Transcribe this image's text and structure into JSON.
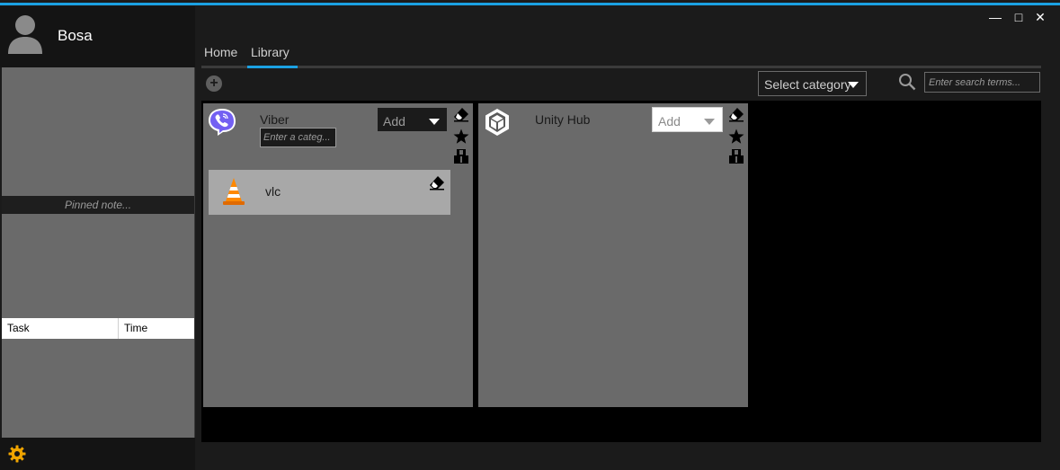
{
  "user": {
    "name": "Bosa"
  },
  "sidebar": {
    "pinned_note": "Pinned note...",
    "task_table": {
      "columns": [
        "Task",
        "Time"
      ]
    }
  },
  "tabs": [
    {
      "label": "Home",
      "active": false
    },
    {
      "label": "Library",
      "active": true
    }
  ],
  "toolbar": {
    "select_category": "Select category",
    "search_placeholder": "Enter search terms..."
  },
  "cards": [
    {
      "name": "Viber",
      "add_label": "Add",
      "category_placeholder": "Enter a categ...",
      "icons": [
        "eraser-icon",
        "star-icon",
        "box-icon"
      ],
      "children": [
        {
          "name": "vlc",
          "icons": [
            "eraser-icon"
          ]
        }
      ]
    },
    {
      "name": "Unity Hub",
      "add_label": "Add",
      "icons": [
        "eraser-icon",
        "star-icon",
        "box-icon"
      ]
    }
  ],
  "colors": {
    "accent": "#1ba1e2",
    "background": "#1b1b1b",
    "panel": "#6a6a6a",
    "gear": "#f0a500",
    "viber": "#7360f2"
  }
}
